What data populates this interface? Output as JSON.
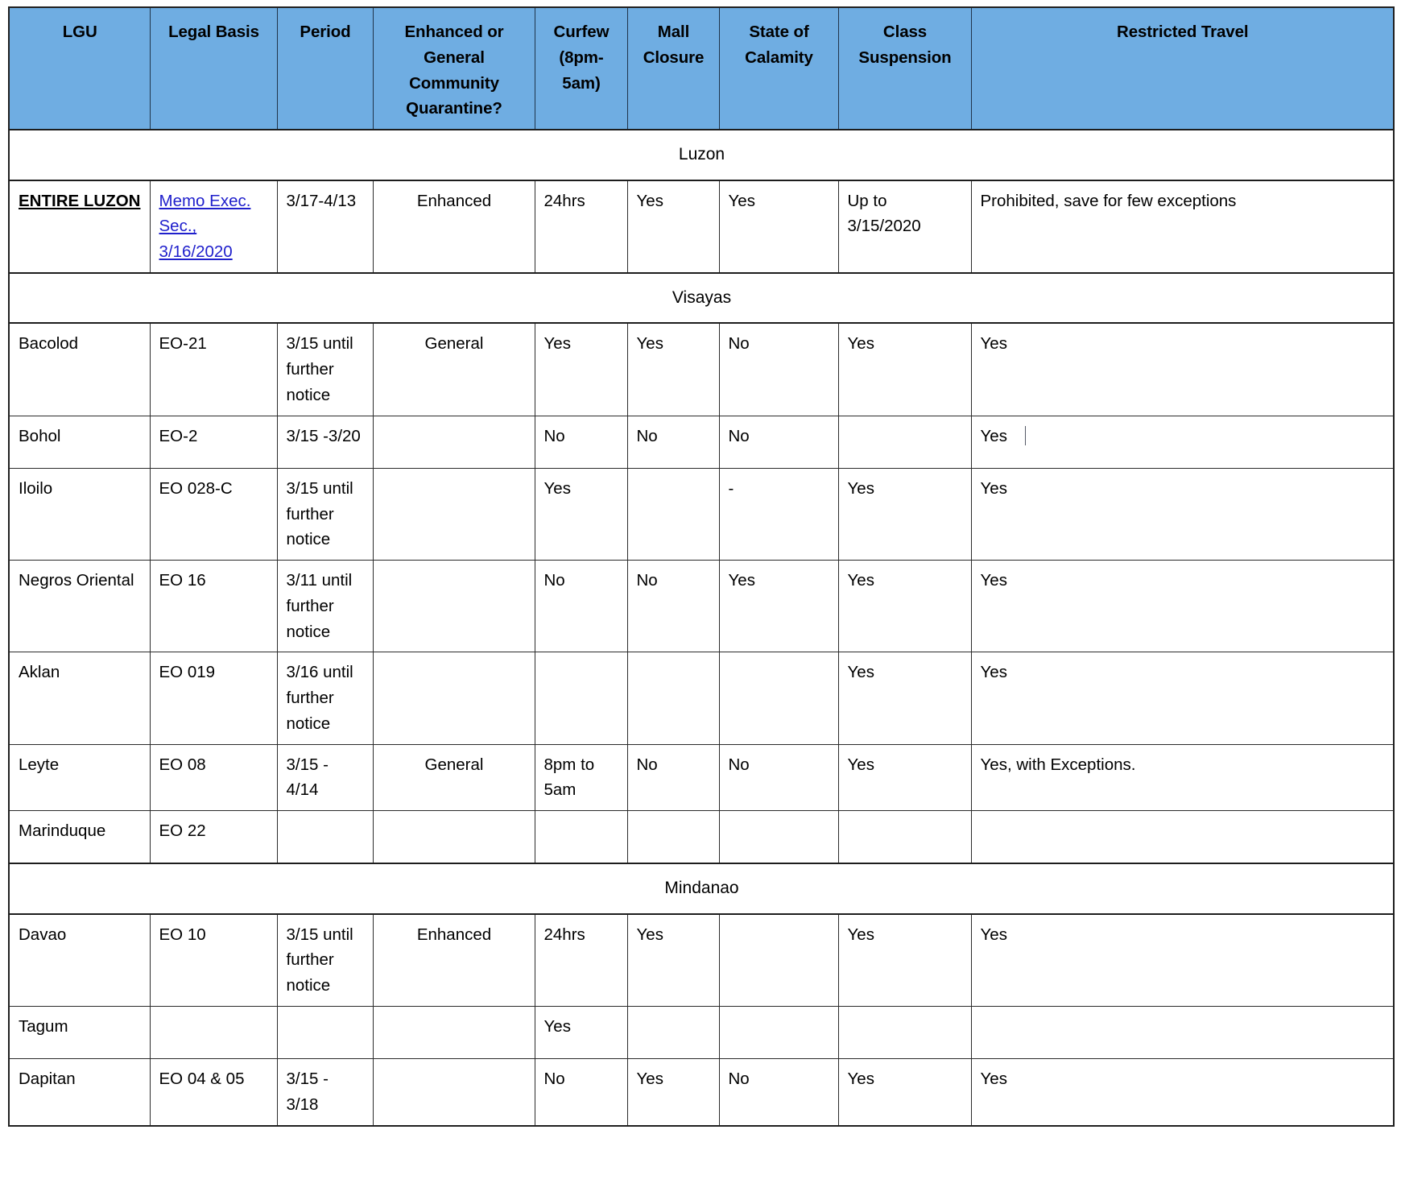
{
  "table": {
    "headers": [
      "LGU",
      "Legal Basis",
      "Period",
      "Enhanced or General Community Quarantine?",
      "Curfew (8pm-5am)",
      "Mall Closure",
      "State of Calamity",
      "Class Suspension",
      "Restricted Travel"
    ],
    "regions": [
      {
        "name": "Luzon",
        "rows": [
          {
            "lgu": "ENTIRE LUZON",
            "lgu_emphasis": true,
            "legal_basis": "Memo Exec. Sec., 3/16/2020",
            "legal_basis_is_link": true,
            "period": "3/17-4/13",
            "quarantine": "Enhanced",
            "curfew": "24hrs",
            "mall_closure": "Yes",
            "state_of_calamity": "Yes",
            "class_suspension": "Up to 3/15/2020",
            "restricted_travel": "Prohibited, save for few exceptions",
            "height_class": "tall-luzon"
          }
        ]
      },
      {
        "name": "Visayas",
        "rows": [
          {
            "lgu": "Bacolod",
            "lgu_emphasis": false,
            "legal_basis": "EO-21",
            "legal_basis_is_link": false,
            "period": "3/15 until further notice",
            "quarantine": "General",
            "curfew": "Yes",
            "mall_closure": "Yes",
            "state_of_calamity": "No",
            "class_suspension": "Yes",
            "restricted_travel": "Yes",
            "height_class": "tall-3"
          },
          {
            "lgu": "Bohol",
            "lgu_emphasis": false,
            "legal_basis": "EO-2",
            "legal_basis_is_link": false,
            "period": "3/15 -3/20",
            "quarantine": "",
            "curfew": "No",
            "mall_closure": "No",
            "state_of_calamity": "No",
            "class_suspension": "",
            "restricted_travel": "Yes",
            "restricted_travel_caret": true,
            "height_class": "tall-1"
          },
          {
            "lgu": "Iloilo",
            "lgu_emphasis": false,
            "legal_basis": "EO 028-C",
            "legal_basis_is_link": false,
            "period": "3/15 until further notice",
            "quarantine": "",
            "curfew": "Yes",
            "mall_closure": "",
            "state_of_calamity": "-",
            "class_suspension": "Yes",
            "restricted_travel": "Yes",
            "height_class": "tall-3"
          },
          {
            "lgu": "Negros Oriental",
            "lgu_emphasis": false,
            "legal_basis": "EO 16",
            "legal_basis_is_link": false,
            "period": "3/11 until further notice",
            "quarantine": "",
            "curfew": "No",
            "mall_closure": "No",
            "state_of_calamity": "Yes",
            "class_suspension": "Yes",
            "restricted_travel": "Yes",
            "height_class": "tall-3"
          },
          {
            "lgu": "Aklan",
            "lgu_emphasis": false,
            "legal_basis": "EO 019",
            "legal_basis_is_link": false,
            "period": "3/16 until further notice",
            "quarantine": "",
            "curfew": "",
            "mall_closure": "",
            "state_of_calamity": "",
            "class_suspension": "Yes",
            "restricted_travel": "Yes",
            "height_class": "tall-3"
          },
          {
            "lgu": "Leyte",
            "lgu_emphasis": false,
            "legal_basis": "EO 08",
            "legal_basis_is_link": false,
            "period": "3/15 - 4/14",
            "quarantine": "General",
            "curfew": "8pm to 5am",
            "mall_closure": "No",
            "state_of_calamity": "No",
            "class_suspension": "Yes",
            "restricted_travel": "Yes, with Exceptions.",
            "height_class": "tall-1"
          },
          {
            "lgu": "Marinduque",
            "lgu_emphasis": false,
            "legal_basis": "EO 22",
            "legal_basis_is_link": false,
            "period": "",
            "quarantine": "",
            "curfew": "",
            "mall_closure": "",
            "state_of_calamity": "",
            "class_suspension": "",
            "restricted_travel": "",
            "height_class": "tall-1"
          }
        ]
      },
      {
        "name": "Mindanao",
        "rows": [
          {
            "lgu": "Davao",
            "lgu_emphasis": false,
            "legal_basis": "EO 10",
            "legal_basis_is_link": false,
            "period": "3/15 until further notice",
            "quarantine": "Enhanced",
            "curfew": "24hrs",
            "mall_closure": "Yes",
            "state_of_calamity": "",
            "class_suspension": "Yes",
            "restricted_travel": "Yes",
            "height_class": "tall-3"
          },
          {
            "lgu": "Tagum",
            "lgu_emphasis": false,
            "legal_basis": "",
            "legal_basis_is_link": false,
            "period": "",
            "quarantine": "",
            "curfew": "Yes",
            "mall_closure": "",
            "state_of_calamity": "",
            "class_suspension": "",
            "restricted_travel": "",
            "height_class": "tall-1"
          },
          {
            "lgu": "Dapitan",
            "lgu_emphasis": false,
            "legal_basis": "EO 04 & 05",
            "legal_basis_is_link": false,
            "period": "3/15 - 3/18",
            "quarantine": "",
            "curfew": "No",
            "mall_closure": "Yes",
            "state_of_calamity": "No",
            "class_suspension": "Yes",
            "restricted_travel": "Yes",
            "height_class": "tall-1"
          }
        ]
      }
    ]
  },
  "colors": {
    "header_background": "#6FADE2",
    "link": "#2020CC",
    "border": "#2B2B2B"
  }
}
